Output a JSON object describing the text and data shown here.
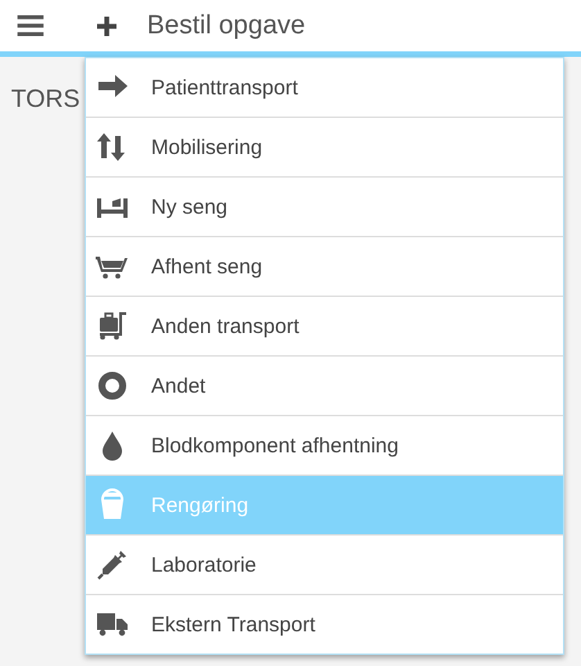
{
  "header": {
    "title": "Bestil opgave"
  },
  "page": {
    "text": "TORS"
  },
  "menu": {
    "items": [
      {
        "label": "Patienttransport",
        "selected": false
      },
      {
        "label": "Mobilisering",
        "selected": false
      },
      {
        "label": "Ny seng",
        "selected": false
      },
      {
        "label": "Afhent seng",
        "selected": false
      },
      {
        "label": "Anden transport",
        "selected": false
      },
      {
        "label": "Andet",
        "selected": false
      },
      {
        "label": "Blodkomponent afhentning",
        "selected": false
      },
      {
        "label": "Rengøring",
        "selected": true
      },
      {
        "label": "Laboratorie",
        "selected": false
      },
      {
        "label": "Ekstern Transport",
        "selected": false
      }
    ]
  }
}
